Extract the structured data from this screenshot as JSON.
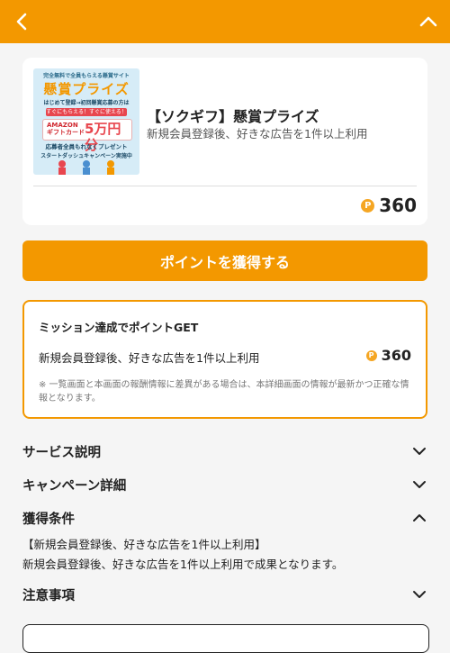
{
  "header": {
    "back_icon": "chevron-left-icon",
    "collapse_icon": "chevron-up-icon",
    "color": "#f39800"
  },
  "offer": {
    "title": "【ソクギフ】懸賞プライズ",
    "subtitle": "新規会員登録後、好きな広告を1件以上利用",
    "points": "360",
    "point_icon": "P",
    "banner": {
      "top_text": "完全無料で全員もらえる懸賞サイト",
      "title": "懸賞プライズ",
      "line1": "はじめて登録→初回懸賞応募の方は",
      "ribbon": "すぐにもらえる！すぐに使える！",
      "gift_brand": "AMAZON",
      "gift_card": "ギフトカード",
      "amount": "5万円分",
      "all_text": "応募者全員もれなくプレゼント",
      "footer": "スタートダッシュキャンペーン実施中"
    }
  },
  "cta": {
    "label": "ポイントを獲得する"
  },
  "mission": {
    "title": "ミッション達成でポイントGET",
    "condition": "新規会員登録後、好きな広告を1件以上利用",
    "points": "360",
    "note": "※ 一覧画面と本画面の報酬情報に差異がある場合は、本詳細画面の情報が最新かつ正確な情報となります。"
  },
  "sections": [
    {
      "label": "サービス説明",
      "state": "collapsed"
    },
    {
      "label": "キャンペーン詳細",
      "state": "collapsed"
    },
    {
      "label": "獲得条件",
      "state": "expanded"
    },
    {
      "label": "注意事項",
      "state": "collapsed"
    }
  ],
  "acquisition": {
    "heading": "【新規会員登録後、好きな広告を1件以上利用】",
    "body": "新規会員登録後、好きな広告を1件以上利用で成果となります。"
  },
  "colors": {
    "accent": "#f39800",
    "coin": "#f5a623",
    "background": "#f5f5f5"
  }
}
